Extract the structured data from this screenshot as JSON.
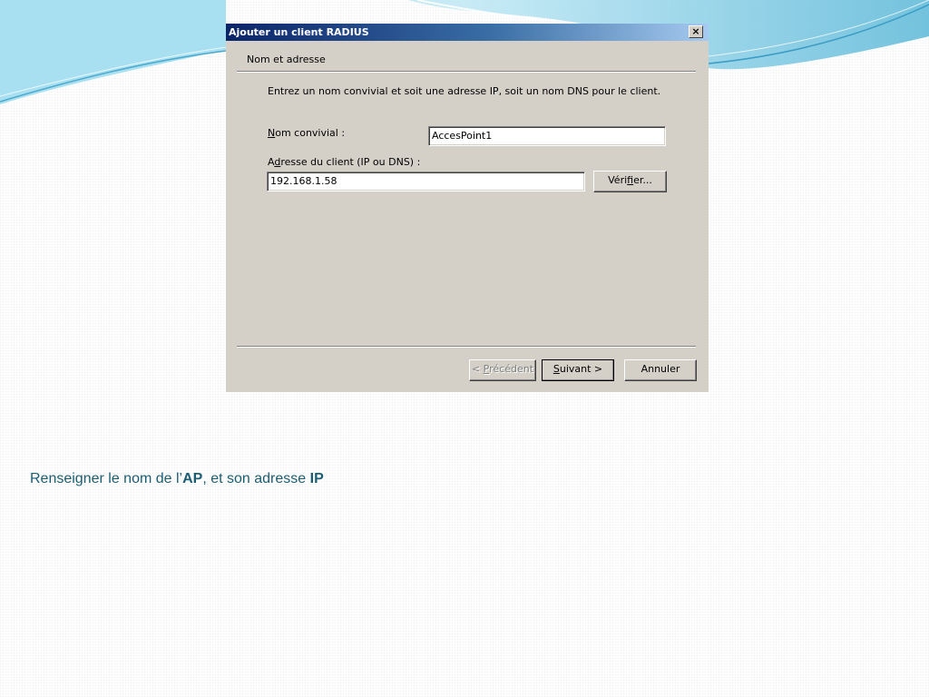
{
  "dialog": {
    "title": "Ajouter un client RADIUS",
    "close_symbol": "×",
    "section_title": "Nom et adresse",
    "instruction": "Entrez un nom convivial et soit une adresse IP, soit un nom DNS pour le client.",
    "friendly_name": {
      "label_mnemonic": "N",
      "label_rest": "om convivial :",
      "value": "AccesPoint1"
    },
    "client_address": {
      "label_first": "A",
      "label_mnemonic": "d",
      "label_rest": "resse du client (IP ou DNS) :",
      "value": "192.168.1.58"
    },
    "buttons": {
      "verify": {
        "pre": "Véri",
        "mnemonic": "f",
        "post": "ier..."
      },
      "previous": {
        "pre": "< ",
        "mnemonic": "P",
        "post": "récédent"
      },
      "next": {
        "mnemonic": "S",
        "post": "uivant >"
      },
      "cancel": "Annuler"
    }
  },
  "caption": {
    "part1": "Renseigner le nom de l’",
    "bold1": "AP",
    "part2": ", et son adresse ",
    "bold2": "IP"
  },
  "colors": {
    "dialog_face": "#d4d0c8",
    "titlebar_start": "#0a246a",
    "titlebar_end": "#a6caf0",
    "caption_text": "#1b5e74",
    "swoosh": "#5bb8d8"
  }
}
